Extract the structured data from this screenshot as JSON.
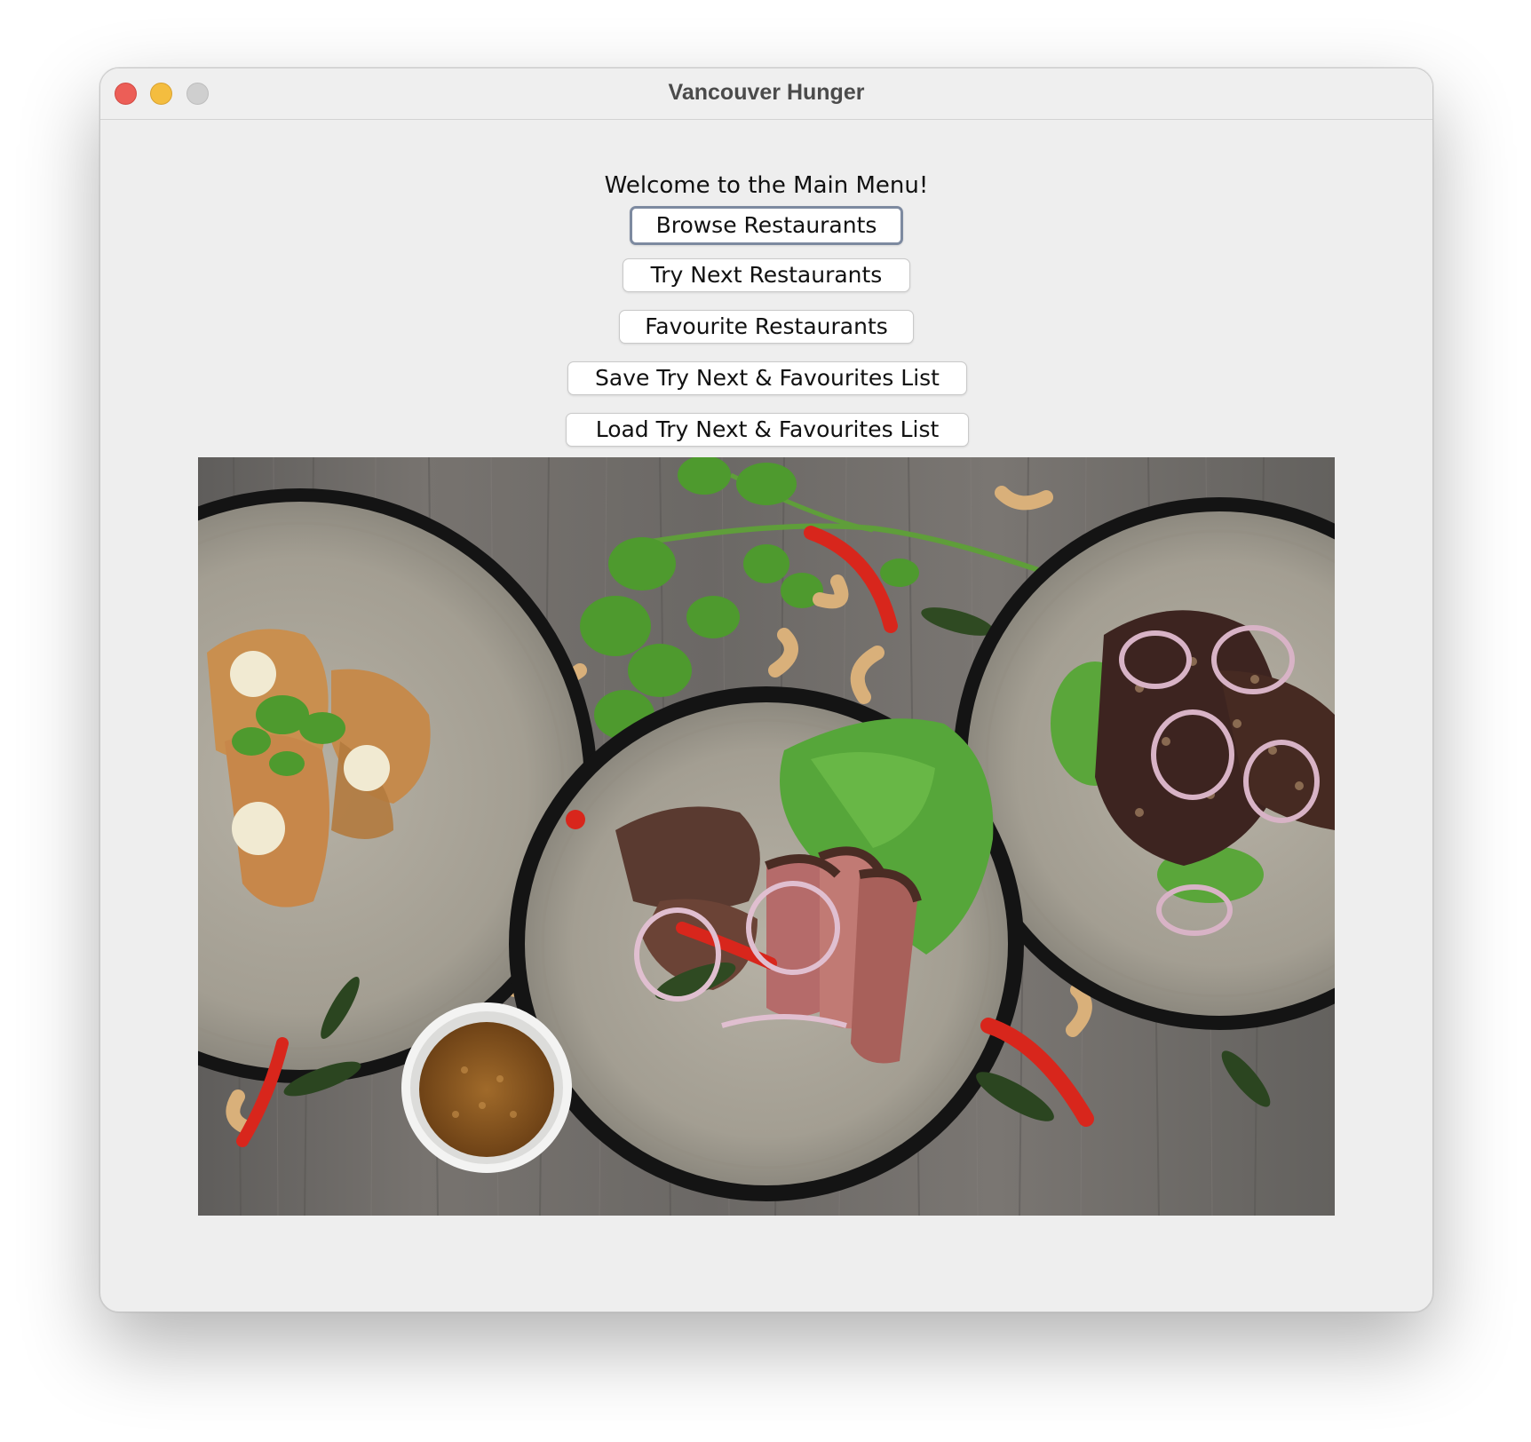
{
  "window": {
    "title": "Vancouver Hunger",
    "controls": [
      "close",
      "minimize",
      "zoom"
    ]
  },
  "main": {
    "welcome": "Welcome to the Main Menu!",
    "buttons": [
      {
        "label": "Browse Restaurants",
        "focused": true
      },
      {
        "label": "Try Next Restaurants",
        "focused": false
      },
      {
        "label": "Favourite Restaurants",
        "focused": false
      },
      {
        "label": "Save Try Next & Favourites List",
        "focused": false
      },
      {
        "label": "Load Try Next & Favourites List",
        "focused": false
      }
    ]
  },
  "image": {
    "subject": "food-photo",
    "colors": {
      "table": "#6f6d6a",
      "bowl_rim": "#1c1c1c",
      "bowl_inner": "#a8a397",
      "lettuce": "#56a63a",
      "chili": "#d8261c",
      "sauce": "#8a5a1e"
    }
  },
  "theme": {
    "window_bg": "#eeeeee",
    "focus_ring": "#7d8aa0",
    "close": "#ec5e57",
    "minimize": "#f4bd3f",
    "zoom_disabled": "#cfcfcf"
  }
}
